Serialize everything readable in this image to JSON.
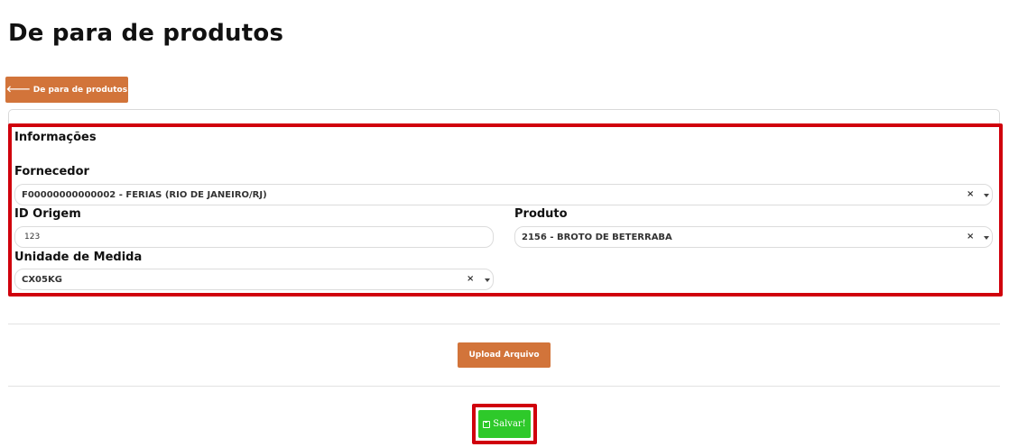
{
  "page_title": "De para de produtos",
  "back_button": {
    "icon": "arrow-left-icon",
    "label": "De para de produtos"
  },
  "section": {
    "title": "Informações"
  },
  "fields": {
    "fornecedor": {
      "label": "Fornecedor",
      "value": "F00000000000002 - FERIAS (RIO DE JANEIRO/RJ)",
      "clear": "×"
    },
    "id_origem": {
      "label": "ID Origem",
      "value": "123"
    },
    "produto": {
      "label": "Produto",
      "value": "2156 - BROTO DE BETERRABA",
      "clear": "×"
    },
    "unidade": {
      "label": "Unidade de Medida",
      "value": "CX05KG",
      "clear": "×"
    }
  },
  "upload_button": {
    "label": "Upload Arquivo"
  },
  "save_button": {
    "icon": "floppy-disk-icon",
    "label": "Salvar!"
  },
  "colors": {
    "accent": "#d2743a",
    "highlight": "#d0000c",
    "save": "#2ec92a"
  }
}
